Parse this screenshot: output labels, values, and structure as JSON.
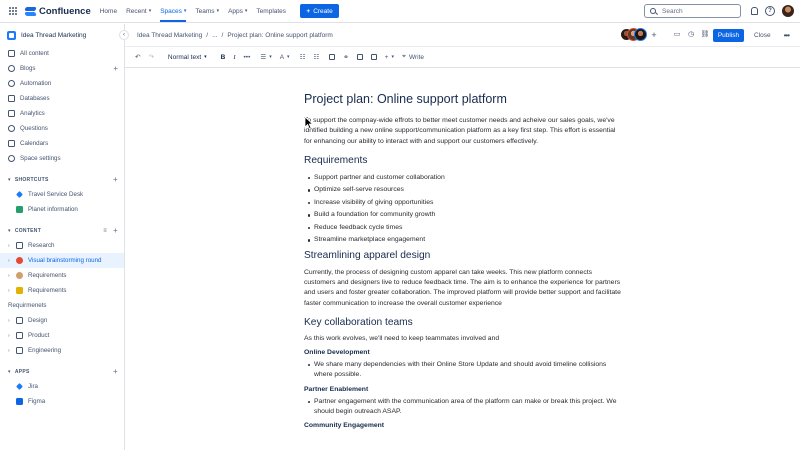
{
  "topnav": {
    "app_name": "Confluence",
    "items": [
      {
        "label": "Home",
        "dropdown": false,
        "active": false
      },
      {
        "label": "Recent",
        "dropdown": true,
        "active": false
      },
      {
        "label": "Spaces",
        "dropdown": true,
        "active": true
      },
      {
        "label": "Teams",
        "dropdown": true,
        "active": false
      },
      {
        "label": "Apps",
        "dropdown": true,
        "active": false
      },
      {
        "label": "Templates",
        "dropdown": false,
        "active": false
      }
    ],
    "create_label": "Create",
    "search_placeholder": "Search"
  },
  "sidebar": {
    "space_name": "Idea Thread Marketing",
    "main_items": [
      {
        "label": "All content",
        "icon": "all-content-icon"
      },
      {
        "label": "Blogs",
        "icon": "blogs-icon",
        "add": true
      },
      {
        "label": "Automation",
        "icon": "automation-icon"
      },
      {
        "label": "Databases",
        "icon": "databases-icon"
      },
      {
        "label": "Analytics",
        "icon": "analytics-icon"
      },
      {
        "label": "Questions",
        "icon": "questions-icon"
      },
      {
        "label": "Calendars",
        "icon": "calendars-icon"
      },
      {
        "label": "Space settings",
        "icon": "settings-icon"
      }
    ],
    "shortcuts_label": "SHORTCUTS",
    "shortcuts": [
      {
        "label": "Travel Service Desk",
        "color": "#1d7afc"
      },
      {
        "label": "Planet information",
        "color": "#22a06b"
      }
    ],
    "content_label": "CONTENT",
    "content_items": [
      {
        "label": "Research",
        "icon": "page-icon",
        "emoji_color": ""
      },
      {
        "label": "Visual brainstorming round",
        "icon": "whiteboard-icon",
        "emoji_color": "#e34935",
        "selected": true
      },
      {
        "label": "Requirements",
        "icon": "page-icon",
        "emoji_color": "#cf9f6c"
      },
      {
        "label": "Requirements",
        "icon": "page-icon",
        "emoji_color": "#e2b203"
      },
      {
        "label": "Requirmenets",
        "icon": "",
        "emoji_color": ""
      },
      {
        "label": "Design",
        "icon": "page-icon",
        "emoji_color": ""
      },
      {
        "label": "Product",
        "icon": "page-icon",
        "emoji_color": ""
      },
      {
        "label": "Engineering",
        "icon": "page-icon",
        "emoji_color": ""
      }
    ],
    "apps_label": "APPS",
    "apps": [
      {
        "label": "Jira",
        "color": "#1d7afc"
      },
      {
        "label": "Figma",
        "color": "#0c66e4"
      }
    ]
  },
  "breadcrumb": {
    "space": "Idea Thread Marketing",
    "ellipsis": "...",
    "page": "Project plan: Online support platform"
  },
  "header_actions": {
    "publish_label": "Publish",
    "close_label": "Close"
  },
  "toolbar": {
    "text_style": "Normal text",
    "write_label": "Write"
  },
  "page": {
    "title": "Project plan: Online support platform",
    "intro": "To support the compnay-wide effrots to better meet customer needs and acheive our sales goals, we've idntified building a new online support/communication platform as a key first step. This effort is essential for enhancing our ability to interact with and support our customers effectively.",
    "requirements_heading": "Requirements",
    "requirements": [
      "Support partner and customer collaboration",
      "Optimize self-serve resources",
      "Increase visibility of giving opportunities",
      "Build a foundation for community growth",
      "Reduce feedback cycle times",
      "Streamline marketplace engagement"
    ],
    "apparel_heading": "Streamlining apparel design",
    "apparel_text": "Currently, the process of designing custom apparel can take weeks. This new platform connects customers and designers live to reduce feedback time. The aim is to enhance the experience for partners and users and foster greater collaboration. The improved platform will provide better support and facilitate faster communication to increase the overall customer experience",
    "teams_heading": "Key collaboration teams",
    "teams_intro": "As this work evolves, we'll need to keep teammates involved and",
    "online_dev_heading": "Online Development",
    "online_dev_item": "We share many dependencies with their Online Store Update and should avoid timeline collisions where possible.",
    "partner_heading": "Partner Enablement",
    "partner_item": "Partner engagement with the communication area of the platform can make or break this project. We should begin outreach ASAP.",
    "community_heading": "Community Engagement"
  }
}
